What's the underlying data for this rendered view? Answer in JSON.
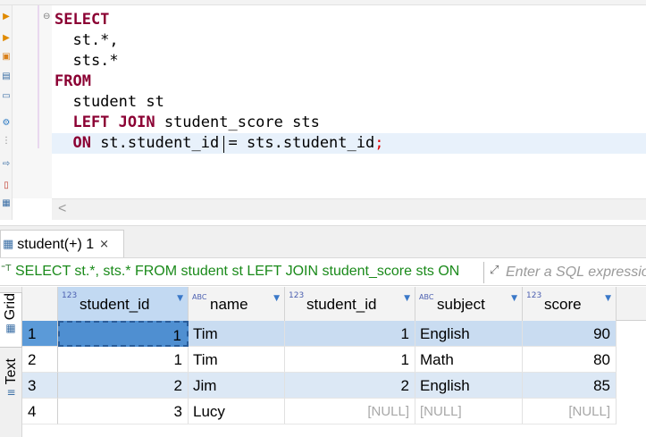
{
  "sql": {
    "lines": [
      {
        "keyword": "SELECT",
        "rest": ""
      },
      {
        "keyword": "",
        "rest": "  st.*,"
      },
      {
        "keyword": "",
        "rest": "  sts.*"
      },
      {
        "keyword": "FROM",
        "rest": ""
      },
      {
        "keyword": "",
        "rest": "  student st"
      },
      {
        "keyword": "  LEFT JOIN",
        "rest": " student_score sts"
      },
      {
        "keyword": "  ON",
        "rest": " st.student_id = sts.student_id",
        "end": ";"
      }
    ]
  },
  "results_tab": {
    "label": "student(+) 1",
    "close_symbol": "×"
  },
  "filter_bar": {
    "query": "SELECT st.*, sts.* FROM student st LEFT JOIN student_score sts ON",
    "placeholder": "Enter a SQL expression to filter results"
  },
  "side_tabs": {
    "grid": "Grid",
    "text": "Text"
  },
  "grid": {
    "columns": [
      {
        "type": "123",
        "name": "student_id"
      },
      {
        "type": "ABC",
        "name": "name"
      },
      {
        "type": "123",
        "name": "student_id"
      },
      {
        "type": "ABC",
        "name": "subject"
      },
      {
        "type": "123",
        "name": "score"
      }
    ],
    "rows": [
      {
        "num": "1",
        "cells": [
          "1",
          "Tim",
          "1",
          "English",
          "90"
        ]
      },
      {
        "num": "2",
        "cells": [
          "1",
          "Tim",
          "1",
          "Math",
          "80"
        ]
      },
      {
        "num": "3",
        "cells": [
          "2",
          "Jim",
          "2",
          "English",
          "85"
        ]
      },
      {
        "num": "4",
        "cells": [
          "3",
          "Lucy",
          "[NULL]",
          "[NULL]",
          "[NULL]"
        ]
      }
    ]
  }
}
